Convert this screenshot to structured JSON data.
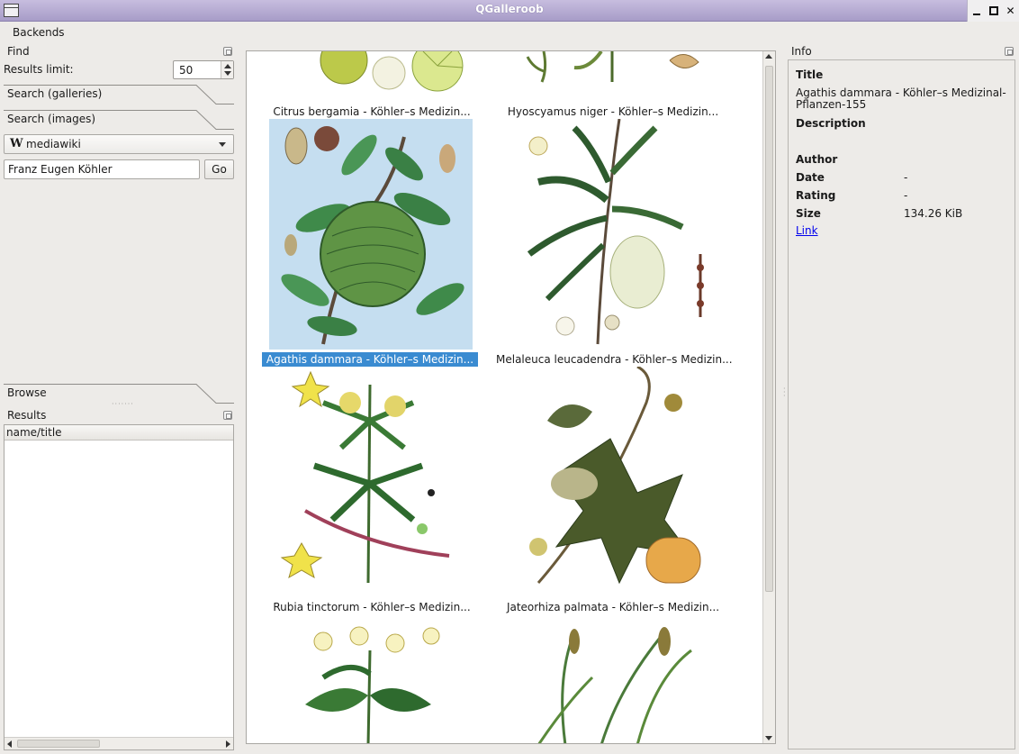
{
  "window": {
    "title": "QGalleroob"
  },
  "menubar": {
    "backends": "Backends"
  },
  "find": {
    "title": "Find",
    "results_limit_label": "Results limit:",
    "results_limit_value": "50",
    "search_galleries": "Search (galleries)",
    "search_images": "Search (images)",
    "backend_selected": "mediawiki",
    "query": "Franz Eugen Köhler",
    "go": "Go"
  },
  "browse": {
    "title": "Browse"
  },
  "results": {
    "title": "Results",
    "column": "name/title"
  },
  "gallery": {
    "items": [
      {
        "caption": "Citrus bergamia - Köhler–s Medizin..."
      },
      {
        "caption": "Hyoscyamus niger - Köhler–s Medizin..."
      },
      {
        "caption": "Agathis dammara - Köhler–s Medizin..."
      },
      {
        "caption": "Melaleuca leucadendra - Köhler–s Medizin..."
      },
      {
        "caption": "Rubia tinctorum - Köhler–s Medizin..."
      },
      {
        "caption": "Jateorhiza palmata - Köhler–s Medizin..."
      }
    ]
  },
  "info": {
    "panel_title": "Info",
    "title_label": "Title",
    "title_value": "Agathis dammara - Köhler–s Medizinal-Pflanzen-155",
    "description_label": "Description",
    "author_label": "Author",
    "date_label": "Date",
    "date_value": "-",
    "rating_label": "Rating",
    "rating_value": "-",
    "size_label": "Size",
    "size_value": "134.26 KiB",
    "link": "Link"
  },
  "colors": {
    "selection": "#3a8bd1",
    "titlebar": "#b3a9d3",
    "link": "#0000ee"
  }
}
